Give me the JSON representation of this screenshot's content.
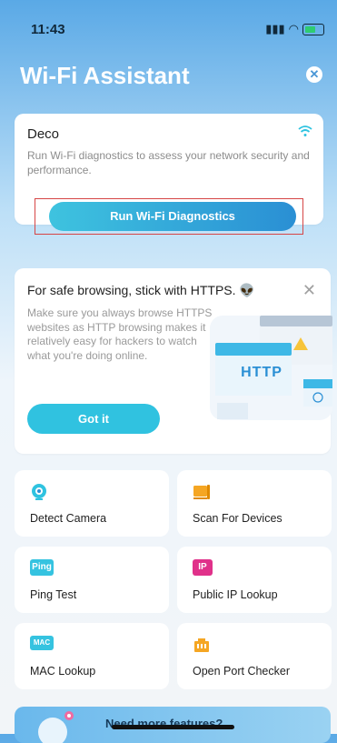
{
  "status_bar": {
    "time": "11:43"
  },
  "header": {
    "title": "Wi-Fi Assistant"
  },
  "deco_card": {
    "name": "Deco",
    "description": "Run Wi-Fi diagnostics to assess your network security and performance.",
    "button_label": "Run Wi-Fi Diagnostics"
  },
  "https_card": {
    "title": "For safe browsing, stick with HTTPS.",
    "description": "Make sure you always browse HTTPS websites as HTTP browsing makes it relatively easy for hackers to watch what you're doing online.",
    "illustration_label": "HTTP",
    "button_label": "Got it"
  },
  "tools": [
    {
      "label": "Detect Camera",
      "icon": "camera-icon"
    },
    {
      "label": "Scan For Devices",
      "icon": "devices-icon"
    },
    {
      "label": "Ping Test",
      "icon": "ping-icon",
      "badge": "Ping"
    },
    {
      "label": "Public IP Lookup",
      "icon": "ip-icon",
      "badge": "IP"
    },
    {
      "label": "MAC Lookup",
      "icon": "mac-icon",
      "badge": "MAC"
    },
    {
      "label": "Open Port Checker",
      "icon": "port-icon"
    }
  ],
  "more_banner": {
    "text": "Need more features?"
  },
  "colors": {
    "accent": "#30c2e0",
    "header_blue": "#5aa9e6",
    "highlight_outline": "#d64545"
  }
}
